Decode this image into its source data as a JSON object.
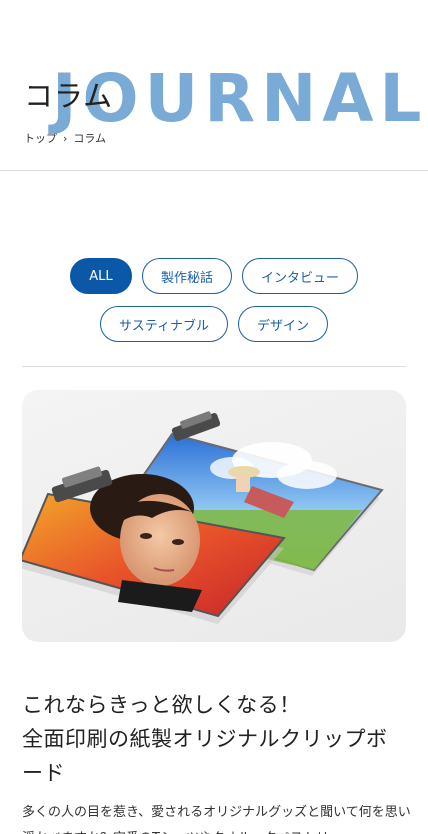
{
  "header": {
    "bg_word": "JOURNAL  JOURNAL",
    "title": "コラム",
    "breadcrumb": {
      "home": "トップ",
      "separator": "›",
      "current": "コラム"
    }
  },
  "categories": {
    "row1": [
      "ALL",
      "製作秘話",
      "インタビュー"
    ],
    "row2": [
      "サスティナブル",
      "デザイン"
    ],
    "active": "ALL"
  },
  "article": {
    "image_alt": "Two custom printed clipboards",
    "title_line1": "これならきっと欲しくなる！",
    "title_line2": "全面印刷の紙製オリジナルクリップボ",
    "title_line3": "ード",
    "excerpt": "多くの人の目を惹き、愛されるオリジナルグッズと聞いて何を思い浮かべますか？定番のTシャツやタオル、タペストリー"
  },
  "colors": {
    "accent": "#0b57a8",
    "bg_word": "#7aaad6"
  }
}
